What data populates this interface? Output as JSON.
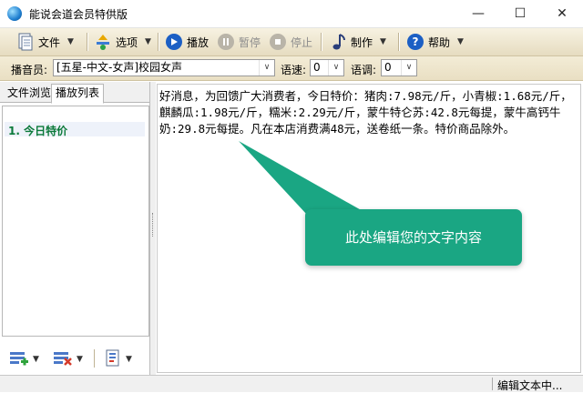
{
  "window": {
    "title": "能说会道会员特供版"
  },
  "toolbar": {
    "file": "文件",
    "options": "选项",
    "play": "播放",
    "pause": "暂停",
    "stop": "停止",
    "make": "制作",
    "help": "帮助"
  },
  "options_bar": {
    "announcer_label": "播音员:",
    "announcer_value": "[五星-中文-女声]校园女声",
    "speed_label": "语速:",
    "speed_value": "0",
    "pitch_label": "语调:",
    "pitch_value": "0"
  },
  "left_panel": {
    "tabs": [
      "文件浏览",
      "播放列表"
    ],
    "items": [
      {
        "label": "1. 今日特价"
      }
    ]
  },
  "editor": {
    "text": "好消息，为回馈广大消费者，今日特价：猪肉:7.98元/斤，小青椒:1.68元/斤，麒麟瓜:1.98元/斤，糯米:2.29元/斤，蒙牛特仑苏:42.8元每提，蒙牛高钙牛奶:29.8元每提。凡在本店消费满48元，送卷纸一条。特价商品除外。"
  },
  "callout": {
    "text": "此处编辑您的文字内容"
  },
  "status": {
    "text": "编辑文本中..."
  },
  "colors": {
    "accent": "#1aa683",
    "list_item": "#0b7a3a",
    "toolbar": "#efe6cc"
  }
}
